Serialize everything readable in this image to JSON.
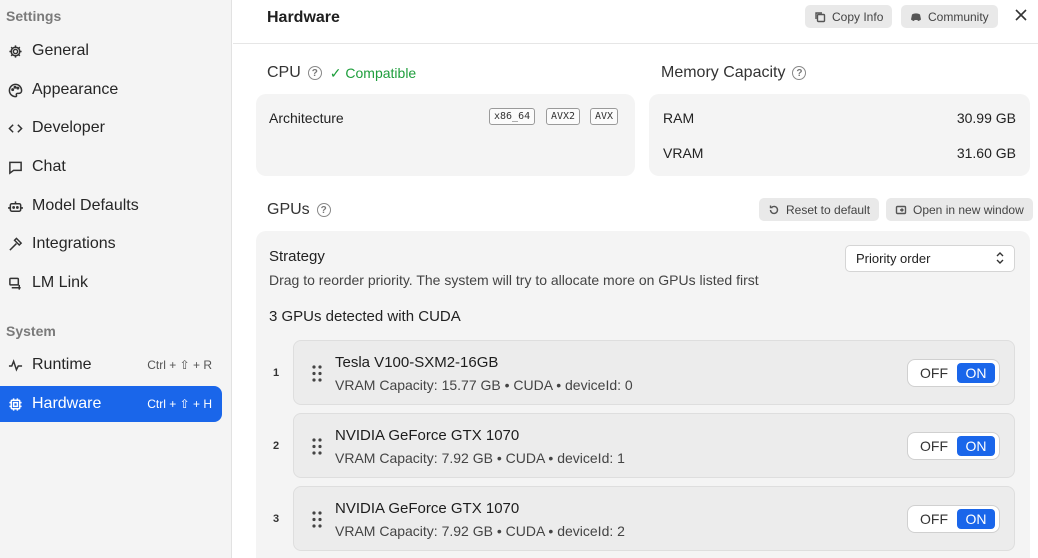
{
  "sidebar": {
    "settings_heading": "Settings",
    "system_heading": "System",
    "items": [
      {
        "label": "General",
        "icon": "gear-icon"
      },
      {
        "label": "Appearance",
        "icon": "palette-icon"
      },
      {
        "label": "Developer",
        "icon": "code-icon"
      },
      {
        "label": "Chat",
        "icon": "chat-icon"
      },
      {
        "label": "Model Defaults",
        "icon": "robot-icon"
      },
      {
        "label": "Integrations",
        "icon": "hammer-icon"
      },
      {
        "label": "LM Link",
        "icon": "link-icon"
      }
    ],
    "system_items": [
      {
        "label": "Runtime",
        "shortcut": "Ctrl + ⇧ + R",
        "icon": "pulse-icon"
      },
      {
        "label": "Hardware",
        "shortcut": "Ctrl + ⇧ + H",
        "icon": "chip-icon",
        "active": true
      }
    ]
  },
  "header": {
    "title": "Hardware",
    "copy_info": "Copy Info",
    "community": "Community"
  },
  "cpu": {
    "title": "CPU",
    "status": "✓ Compatible",
    "arch_label": "Architecture",
    "tags": [
      "x86_64",
      "AVX2",
      "AVX"
    ]
  },
  "memory": {
    "title": "Memory Capacity",
    "rows": [
      {
        "label": "RAM",
        "value": "30.99 GB"
      },
      {
        "label": "VRAM",
        "value": "31.60 GB"
      }
    ]
  },
  "gpus": {
    "title": "GPUs",
    "reset_label": "Reset to default",
    "open_window_label": "Open in new window",
    "strategy_title": "Strategy",
    "strategy_desc": "Drag to reorder priority. The system will try to allocate more on GPUs listed first",
    "strategy_value": "Priority order",
    "detected": "3 GPUs detected with CUDA",
    "off_label": "OFF",
    "on_label": "ON",
    "list": [
      {
        "num": "1",
        "name": "Tesla V100-SXM2-16GB",
        "details": "VRAM Capacity: 15.77 GB • CUDA • deviceId: 0"
      },
      {
        "num": "2",
        "name": "NVIDIA GeForce GTX 1070",
        "details": "VRAM Capacity: 7.92 GB • CUDA • deviceId: 1"
      },
      {
        "num": "3",
        "name": "NVIDIA GeForce GTX 1070",
        "details": "VRAM Capacity: 7.92 GB • CUDA • deviceId: 2"
      }
    ]
  },
  "colors": {
    "accent": "#1a66ea",
    "compatible": "#1e9e3c"
  }
}
